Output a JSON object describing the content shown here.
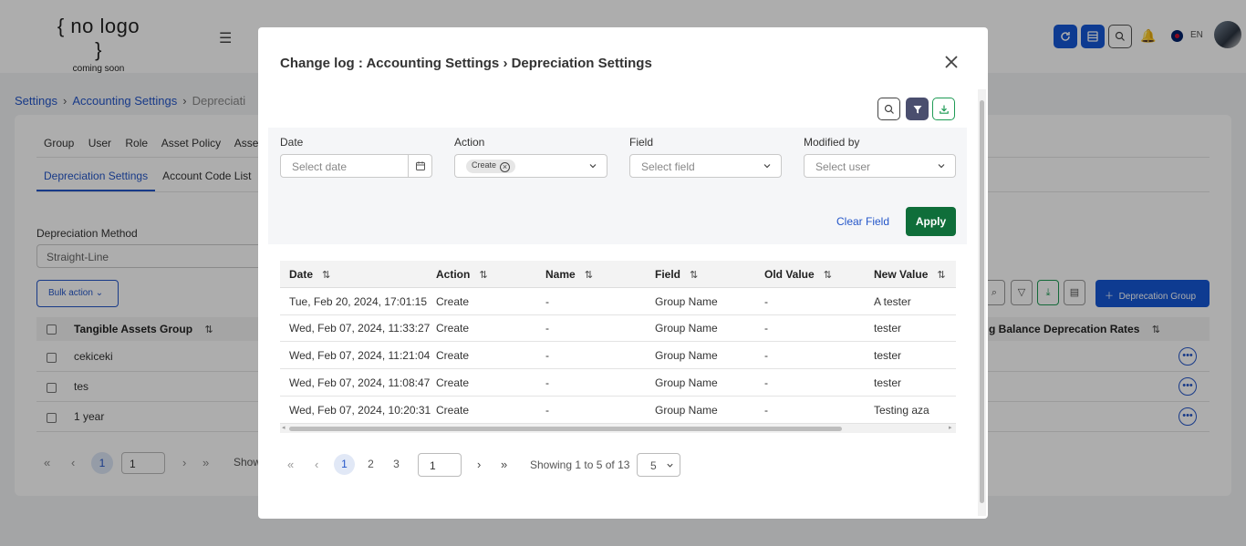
{
  "app": {
    "logo_main": "{ no logo }",
    "logo_sub": "coming soon",
    "language": "EN"
  },
  "breadcrumb": {
    "items": [
      "Settings",
      "Accounting Settings",
      "Depreciati"
    ]
  },
  "page": {
    "tabs_primary": [
      "Group",
      "User",
      "Role",
      "Asset Policy",
      "Asse"
    ],
    "tabs_secondary": [
      "Depreciation Settings",
      "Account Code List"
    ],
    "depreciation_method_label": "Depreciation Method",
    "depreciation_method_value": "Straight-Line",
    "bulk_action_label": "Bulk action",
    "add_group_label": "Deprecation Group",
    "table_headers": [
      "Tangible Assets Group",
      "g Balance Deprecation Rates"
    ],
    "rows": [
      "cekiceki",
      "tes",
      "1 year"
    ],
    "pager_page": "1",
    "pager_input": "1",
    "pager_show_label": "Show"
  },
  "modal": {
    "title": "Change log : Accounting Settings › Depreciation Settings",
    "filters": {
      "date_label": "Date",
      "date_placeholder": "Select date",
      "action_label": "Action",
      "action_chip": "Create",
      "field_label": "Field",
      "field_placeholder": "Select field",
      "modified_by_label": "Modified by",
      "modified_by_placeholder": "Select user",
      "clear_label": "Clear Field",
      "apply_label": "Apply"
    },
    "table": {
      "headers": [
        "Date",
        "Action",
        "Name",
        "Field",
        "Old Value",
        "New Value"
      ],
      "rows": [
        [
          "Tue, Feb 20, 2024, 17:01:15",
          "Create",
          "-",
          "Group Name",
          "-",
          "A tester"
        ],
        [
          "Wed, Feb 07, 2024, 11:33:27",
          "Create",
          "-",
          "Group Name",
          "-",
          "tester"
        ],
        [
          "Wed, Feb 07, 2024, 11:21:04",
          "Create",
          "-",
          "Group Name",
          "-",
          "tester"
        ],
        [
          "Wed, Feb 07, 2024, 11:08:47",
          "Create",
          "-",
          "Group Name",
          "-",
          "tester"
        ],
        [
          "Wed, Feb 07, 2024, 10:20:31",
          "Create",
          "-",
          "Group Name",
          "-",
          "Testing aza"
        ]
      ]
    },
    "pagination": {
      "pages": [
        "1",
        "2",
        "3"
      ],
      "current_page_input": "1",
      "showing_text": "Showing 1 to 5 of 13",
      "page_size": "5"
    }
  },
  "colors": {
    "primary": "#1558d6",
    "link": "#2456c9",
    "apply": "#0f6e3a",
    "filter_active": "#4a4e6e"
  }
}
